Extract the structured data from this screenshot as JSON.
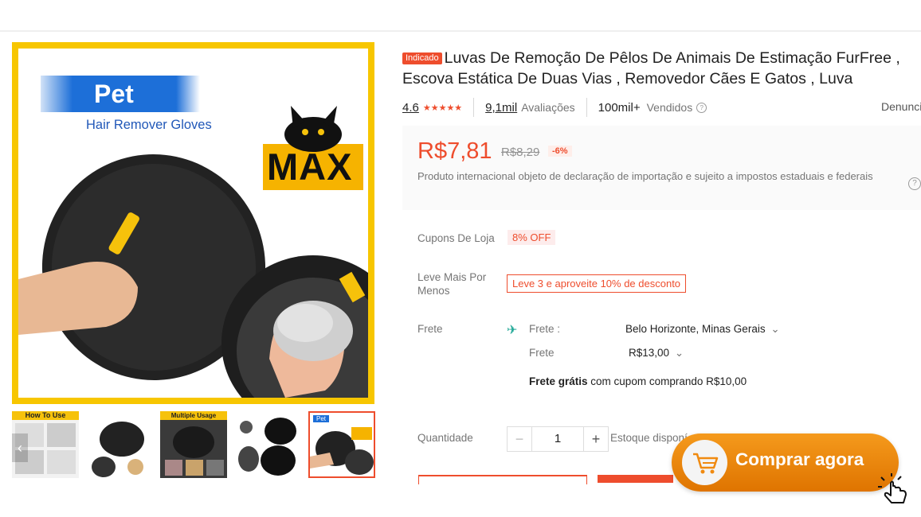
{
  "gallery": {
    "promo_heading": "Pet",
    "promo_subheading": "Hair Remover Gloves",
    "brand_logo_text": "MAX",
    "thumbnails": [
      {
        "caption": "How To Use"
      },
      {
        "caption": ""
      },
      {
        "caption": "Multiple Usage Scenarios"
      },
      {
        "caption": ""
      },
      {
        "caption": "Pet",
        "active": true
      }
    ],
    "prev_arrow_icon": "chevron-left-icon"
  },
  "product": {
    "badge": "Indicado",
    "title": "Luvas De Remoção De Pêlos De Animais De Estimação FurFree , Escova Estática De Duas Vias , Removedor Cães E Gatos , Luva",
    "rating": "4.6",
    "stars": "★★★★★",
    "reviews_count": "9,1mil",
    "reviews_label": "Avaliações",
    "sold_count": "100mil+",
    "sold_label": "Vendidos",
    "report_link": "Denunci"
  },
  "price": {
    "current": "R$7,81",
    "original": "R$8,29",
    "discount": "-6%",
    "international_note": "Produto internacional objeto de declaração de importação e sujeito a impostos estaduais e federais"
  },
  "offers": {
    "store_coupons_label": "Cupons De Loja",
    "store_coupon_value": "8% OFF",
    "bundle_label": "Leve Mais Por Menos",
    "bundle_value": "Leve 3 e aproveite 10% de desconto"
  },
  "shipping": {
    "label": "Frete",
    "to_label": "Frete :",
    "destination": "Belo Horizonte, Minas Gerais",
    "cost_label": "Frete",
    "cost_value": "R$13,00",
    "free_bold": "Frete grátis",
    "free_rest": "com cupom comprando R$10,00"
  },
  "quantity": {
    "label": "Quantidade",
    "minus": "−",
    "value": "1",
    "plus": "+",
    "stock_text": "Estoque disponí"
  },
  "cta": {
    "label": "Comprar agora"
  },
  "colors": {
    "accent": "#ee4d2d",
    "cta_orange": "#f08a10",
    "frame_yellow": "#f7c600"
  }
}
